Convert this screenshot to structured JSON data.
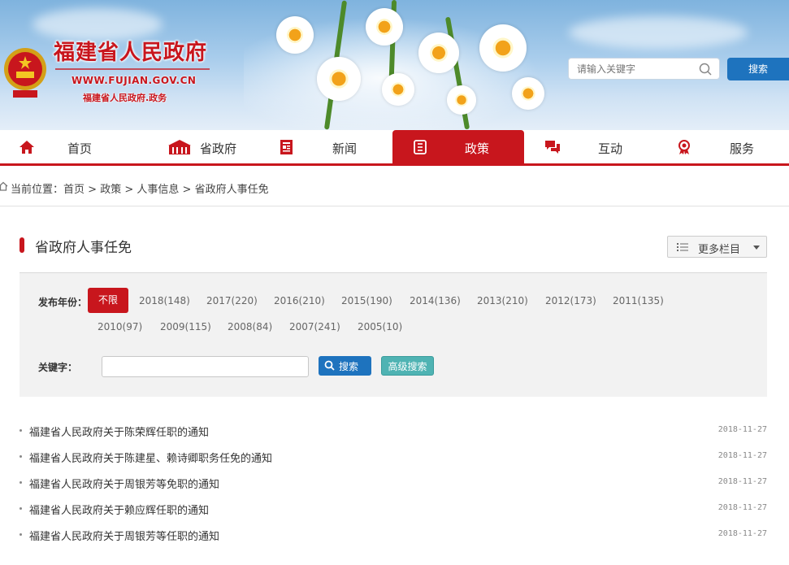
{
  "header": {
    "site_title": "福建省人民政府",
    "site_url": "WWW.FUJIAN.GOV.CN",
    "site_subtitle": "福建省人民政府.政务",
    "search": {
      "placeholder": "请输入关键字",
      "button_label": "搜索"
    }
  },
  "nav": {
    "items": [
      {
        "label": "首页",
        "icon": "home-icon"
      },
      {
        "label": "省政府",
        "icon": "building-icon"
      },
      {
        "label": "新闻",
        "icon": "newspaper-icon"
      },
      {
        "label": "政策",
        "icon": "document-icon",
        "active": true
      },
      {
        "label": "互动",
        "icon": "chat-icon"
      },
      {
        "label": "服务",
        "icon": "service-icon"
      }
    ],
    "active_color": "#c8161d"
  },
  "breadcrumb": {
    "prefix": "当前位置：",
    "items": [
      "首页",
      "政策",
      "人事信息",
      "省政府人事任免"
    ],
    "separator": " > "
  },
  "section": {
    "title": "省政府人事任免",
    "more_button_label": "更多栏目"
  },
  "filter": {
    "year_label": "发布年份：",
    "years": [
      "不限",
      "2018(148)",
      "2017(220)",
      "2016(210)",
      "2015(190)",
      "2014(136)",
      "2013(210)",
      "2012(173)",
      "2011(135)",
      "2010(97)",
      "2009(115)",
      "2008(84)",
      "2007(241)",
      "2005(10)"
    ],
    "active_year": "不限",
    "keyword_label": "关键字：",
    "keyword_value": "",
    "search_button_label": "搜索",
    "advanced_button_label": "高级搜索"
  },
  "articles": [
    {
      "title": "福建省人民政府关于陈荣辉任职的通知",
      "date": "2018-11-27"
    },
    {
      "title": "福建省人民政府关于陈建星、赖诗卿职务任免的通知",
      "date": "2018-11-27"
    },
    {
      "title": "福建省人民政府关于周银芳等免职的通知",
      "date": "2018-11-27"
    },
    {
      "title": "福建省人民政府关于赖应辉任职的通知",
      "date": "2018-11-27"
    },
    {
      "title": "福建省人民政府关于周银芳等任职的通知",
      "date": "2018-11-27"
    }
  ],
  "colors": {
    "brand_red": "#c8161d",
    "search_blue": "#1e73be",
    "advanced_teal": "#4fb3b3"
  }
}
